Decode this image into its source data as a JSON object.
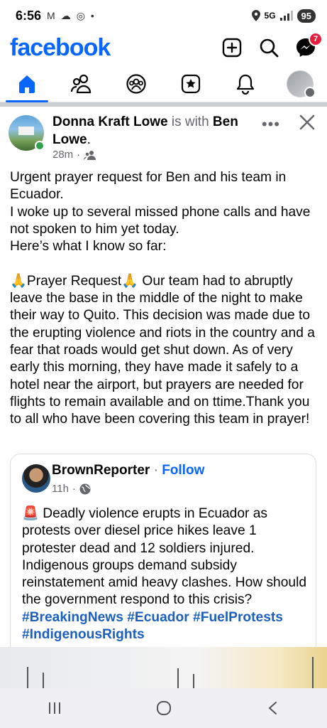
{
  "status_bar": {
    "time": "6:56",
    "network": "5G",
    "battery": "95"
  },
  "header": {
    "logo": "facebook",
    "messenger_badge": "7"
  },
  "nav": {
    "tabs": [
      "home",
      "friends",
      "groups",
      "marketplace",
      "notifications",
      "profile"
    ]
  },
  "post": {
    "author": "Donna Kraft Lowe",
    "with_text": " is with ",
    "tagged": "Ben Lowe",
    "tagged_suffix": ".",
    "time": "28m",
    "separator": "·",
    "more": "•••",
    "body": "Urgent prayer request for Ben and his team in Ecuador.\nI woke up to several missed phone calls and have not spoken to him yet today.\nHere’s what I know so far:\n\n🙏Prayer Request🙏 Our team had to abruptly leave the base in the middle of the night to make their way to Quito. This decision was made due to the erupting violence and riots in the country and a fear that roads would get shut down. As of very early this morning, they have made it safely to a hotel near the airport, but prayers are needed for flights to remain available and on ttime.Thank you to all who have been covering this team in prayer!"
  },
  "shared": {
    "author": "BrownReporter",
    "sep": " · ",
    "follow": "Follow",
    "time": "11h",
    "time_sep": "·",
    "body": "🚨 Deadly violence erupts in Ecuador as protests over diesel price hikes leave 1 protester dead and 12 soldiers injured. Indigenous groups demand subsidy reinstatement amid heavy clashes. How should the government respond to this crisis? ",
    "tags": [
      "#BreakingNews",
      "#Ecuador",
      "#FuelProtests",
      "#IndigenousRights"
    ]
  },
  "colors": {
    "brand": "#0866ff",
    "badge": "#e41e3f",
    "hashtag": "#1d5fbf"
  }
}
